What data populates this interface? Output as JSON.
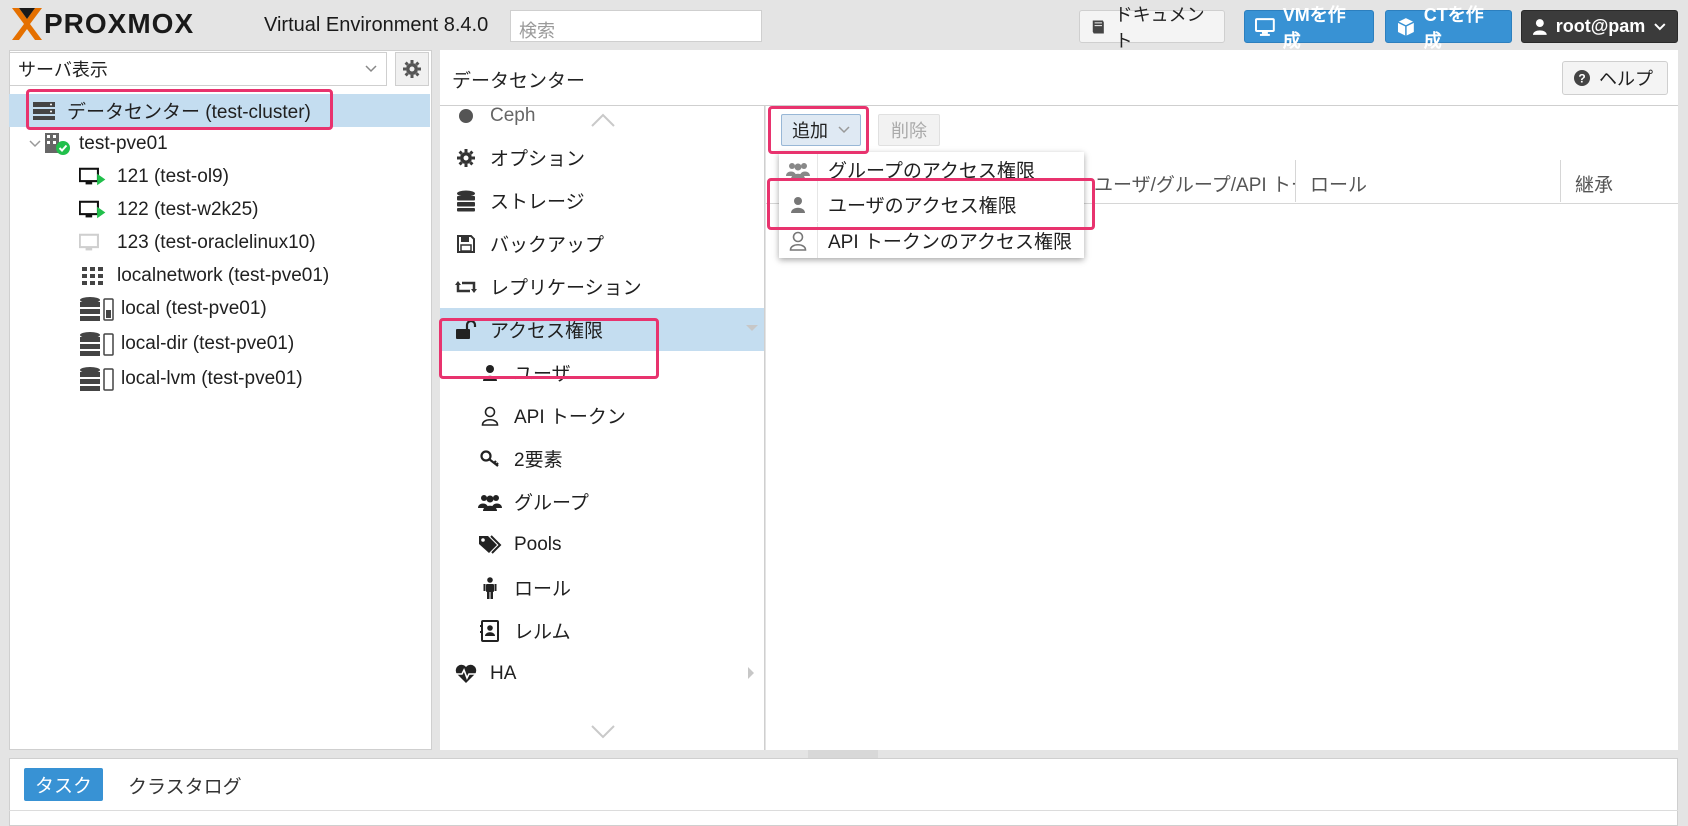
{
  "header": {
    "logo_prefix": "",
    "logo_text": "PROXMOX",
    "version": "Virtual Environment 8.4.0",
    "search_placeholder": "検索",
    "docs_label": "ドキュメント",
    "create_vm_label": "VMを作成",
    "create_ct_label": "CTを作成",
    "user_label": "root@pam"
  },
  "tree": {
    "view_select": "サーバ表示",
    "items": [
      {
        "label": "データセンター (test-cluster)"
      },
      {
        "label": "test-pve01"
      },
      {
        "label": "121 (test-ol9)"
      },
      {
        "label": "122 (test-w2k25)"
      },
      {
        "label": "123 (test-oraclelinux10)"
      },
      {
        "label": "localnetwork (test-pve01)"
      },
      {
        "label": "local (test-pve01)"
      },
      {
        "label": "local-dir (test-pve01)"
      },
      {
        "label": "local-lvm (test-pve01)"
      }
    ]
  },
  "center": {
    "title": "データセンター",
    "help_label": "ヘルプ"
  },
  "menu": {
    "items": [
      {
        "label": "Ceph"
      },
      {
        "label": "オプション"
      },
      {
        "label": "ストレージ"
      },
      {
        "label": "バックアップ"
      },
      {
        "label": "レプリケーション"
      },
      {
        "label": "アクセス権限"
      },
      {
        "label": "ユーザ"
      },
      {
        "label": "API トークン"
      },
      {
        "label": "2要素"
      },
      {
        "label": "グループ"
      },
      {
        "label": "Pools"
      },
      {
        "label": "ロール"
      },
      {
        "label": "レルム"
      },
      {
        "label": "HA"
      }
    ]
  },
  "content": {
    "add_label": "追加",
    "delete_label": "削除",
    "columns": [
      "ユーザ/グループ/API トークン",
      "ロール",
      "継承"
    ],
    "dropdown": [
      {
        "label": "グループのアクセス権限"
      },
      {
        "label": "ユーザのアクセス権限"
      },
      {
        "label": "API トークンのアクセス権限"
      }
    ]
  },
  "bottom": {
    "tasks_label": "タスク",
    "cluster_log_label": "クラスタログ"
  },
  "colors": {
    "accent": "#3892d4",
    "selected": "#c4ddf0",
    "highlight": "#e8336e",
    "logo_orange": "#e57000"
  }
}
